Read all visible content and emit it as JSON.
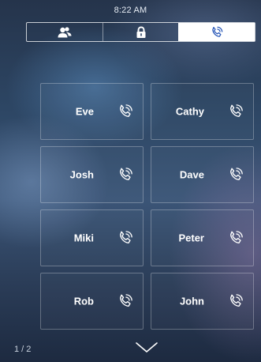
{
  "status_bar": {
    "time": "8:22 AM"
  },
  "tabs": [
    {
      "icon": "contacts-icon",
      "active": false
    },
    {
      "icon": "lock-icon",
      "active": false
    },
    {
      "icon": "phone-call-icon",
      "active": true
    }
  ],
  "contacts": [
    {
      "name": "Eve"
    },
    {
      "name": "Cathy"
    },
    {
      "name": "Josh"
    },
    {
      "name": "Dave"
    },
    {
      "name": "Miki"
    },
    {
      "name": "Peter"
    },
    {
      "name": "Rob"
    },
    {
      "name": "John"
    }
  ],
  "pagination": {
    "indicator": "1 / 2"
  },
  "colors": {
    "accent": "#1e4fb4",
    "text": "#ffffff"
  }
}
